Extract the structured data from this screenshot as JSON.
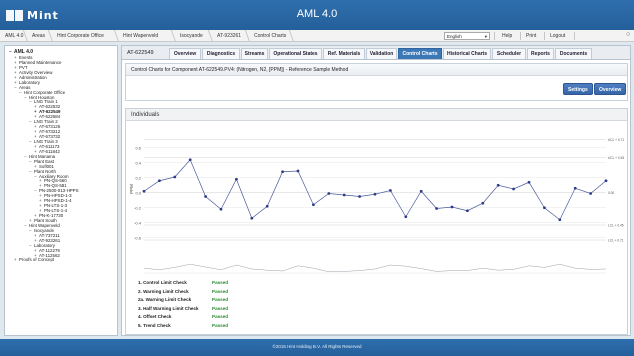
{
  "app": {
    "logo_text": "Mint",
    "title": "AML 4.0"
  },
  "breadcrumbs": [
    "AML 4.0",
    "Areas",
    "Hint Corporate Office",
    "Hint Wapenveld",
    "Isocyande",
    "AT-923261",
    "Control Charts"
  ],
  "topnav": {
    "language": "English",
    "help": "Help",
    "print": "Print",
    "logout": "Logout"
  },
  "tree": [
    {
      "t": "AML 4.0",
      "d": 0,
      "g": "−",
      "root": true
    },
    {
      "t": "Events",
      "d": 1,
      "g": "+"
    },
    {
      "t": "Planned Maintenance",
      "d": 1,
      "g": "+"
    },
    {
      "t": "PVT",
      "d": 1,
      "g": "+"
    },
    {
      "t": "Activity Overview",
      "d": 1,
      "g": "+"
    },
    {
      "t": "Administration",
      "d": 1,
      "g": "+"
    },
    {
      "t": "Laboratory",
      "d": 1,
      "g": "+"
    },
    {
      "t": "Areas",
      "d": 1,
      "g": "−"
    },
    {
      "t": "Hint Corporate Office",
      "d": 2,
      "g": "−"
    },
    {
      "t": "Hint Houston",
      "d": 3,
      "g": "−"
    },
    {
      "t": "LNG Train 1",
      "d": 4,
      "g": "−"
    },
    {
      "t": "AT-622532",
      "d": 5,
      "g": "+"
    },
    {
      "t": "AT-622549",
      "d": 5,
      "g": "+",
      "sel": true
    },
    {
      "t": "AT-622584",
      "d": 5,
      "g": "+"
    },
    {
      "t": "LNG Train 2",
      "d": 4,
      "g": "−"
    },
    {
      "t": "AT-673126",
      "d": 5,
      "g": "+"
    },
    {
      "t": "AT-673212",
      "d": 5,
      "g": "+"
    },
    {
      "t": "AT-673732",
      "d": 5,
      "g": "+"
    },
    {
      "t": "LNG Train 3",
      "d": 4,
      "g": "−"
    },
    {
      "t": "AT-611173",
      "d": 5,
      "g": "+"
    },
    {
      "t": "AT-611842",
      "d": 5,
      "g": "+"
    },
    {
      "t": "Hint Manama",
      "d": 3,
      "g": "−"
    },
    {
      "t": "Plant East",
      "d": 4,
      "g": "−"
    },
    {
      "t": "Sofl001",
      "d": 5,
      "g": "+"
    },
    {
      "t": "Plant North",
      "d": 4,
      "g": "−"
    },
    {
      "t": "Auxiliary Room",
      "d": 5,
      "g": "−"
    },
    {
      "t": "PN-QS-560",
      "d": 6,
      "g": "+"
    },
    {
      "t": "PN-QS-581",
      "d": 6,
      "g": "+"
    },
    {
      "t": "PN-2500-013-HPPS",
      "d": 5,
      "g": "−"
    },
    {
      "t": "PN-HPSD-1-3",
      "d": 6,
      "g": "+"
    },
    {
      "t": "PN-HPSD-1-4",
      "d": 6,
      "g": "+"
    },
    {
      "t": "PN-LTS-1-3",
      "d": 6,
      "g": "+"
    },
    {
      "t": "PN-LTS-1-4",
      "d": 6,
      "g": "+"
    },
    {
      "t": "PN-K-17730",
      "d": 5,
      "g": "+"
    },
    {
      "t": "Plant South",
      "d": 4,
      "g": "+"
    },
    {
      "t": "Hint Wapenveld",
      "d": 3,
      "g": "−"
    },
    {
      "t": "Isocyande",
      "d": 4,
      "g": "−"
    },
    {
      "t": "AT-737211",
      "d": 5,
      "g": "+"
    },
    {
      "t": "AT-923261",
      "d": 5,
      "g": "+"
    },
    {
      "t": "Laboratory",
      "d": 4,
      "g": "−"
    },
    {
      "t": "AT-112279",
      "d": 5,
      "g": "+"
    },
    {
      "t": "AT-112562",
      "d": 5,
      "g": "+"
    },
    {
      "t": "Proofs of Concept",
      "d": 1,
      "g": "+"
    }
  ],
  "component_label": "AT-622549",
  "tabs": [
    "Overview",
    "Diagnostics",
    "Streams",
    "Operational States",
    "Ref. Materials",
    "Validation",
    "Control Charts",
    "Historical Charts",
    "Scheduler",
    "Reports",
    "Documents"
  ],
  "active_tab": "Control Charts",
  "panel_title": "Control Charts for Component AT-622549.PV4: (Nitrogen, N2, [PPM]) - Reference Sample Method",
  "buttons": {
    "settings": "Settings",
    "overview": "Overview"
  },
  "chart_title": "Individuals",
  "chart_data": {
    "type": "line",
    "ylabel": "PPM",
    "ylim": [
      -0.75,
      0.85
    ],
    "yticks": [
      0.6,
      0.4,
      0.2,
      0.0,
      -0.2,
      -0.4,
      -0.6
    ],
    "ytick_labels": [
      "0.6",
      "0.4",
      "0.2",
      "0.0",
      "-0.2",
      "-0.4",
      "-0.6"
    ],
    "limits": [
      {
        "label": "UCL + 0.71",
        "y": 0.71
      },
      {
        "label": "UCL + 0.45",
        "y": 0.47
      },
      {
        "label": "0.00",
        "y": 0.0
      },
      {
        "label": "LCL + 0.45",
        "y": -0.43
      },
      {
        "label": "LCL + 0.71",
        "y": -0.63
      }
    ],
    "values": [
      0.02,
      0.16,
      0.21,
      0.44,
      -0.05,
      -0.22,
      0.18,
      -0.34,
      -0.18,
      0.28,
      0.29,
      -0.16,
      -0.01,
      -0.03,
      -0.05,
      -0.02,
      0.03,
      -0.32,
      0.02,
      -0.21,
      -0.19,
      -0.24,
      -0.14,
      0.1,
      0.05,
      0.14,
      -0.2,
      -0.36,
      0.06,
      -0.01,
      0.16
    ],
    "mr_values": [
      0.12,
      0.08,
      0.14,
      0.22,
      0.15,
      0.08,
      0.2,
      0.1,
      0.07,
      0.05,
      0.18,
      0.12,
      0.03,
      0.04,
      0.06,
      0.1,
      0.2,
      0.17,
      0.11,
      0.04,
      0.06,
      0.06,
      0.12,
      0.07,
      0.09,
      0.18,
      0.14,
      0.22,
      0.12,
      0.09,
      0.1
    ]
  },
  "checks": [
    {
      "name": "1. Control Limit Check",
      "status": "Passed"
    },
    {
      "name": "2. Warning Limit Check",
      "status": "Passed"
    },
    {
      "name": "2a. Warning Limit Check",
      "status": "Passed"
    },
    {
      "name": "3. Half Warning Limit Check",
      "status": "Passed"
    },
    {
      "name": "4. Offset Check",
      "status": "Passed"
    },
    {
      "name": "5. Trend Check",
      "status": "Passed"
    }
  ],
  "footer": "©2015 Hint Holding B.V. All Rights Reserved",
  "colors": {
    "header": "#2f6fae",
    "active_tab": "#3d78b6",
    "series": "#2e3c8a",
    "passed": "#2a8a2a"
  }
}
